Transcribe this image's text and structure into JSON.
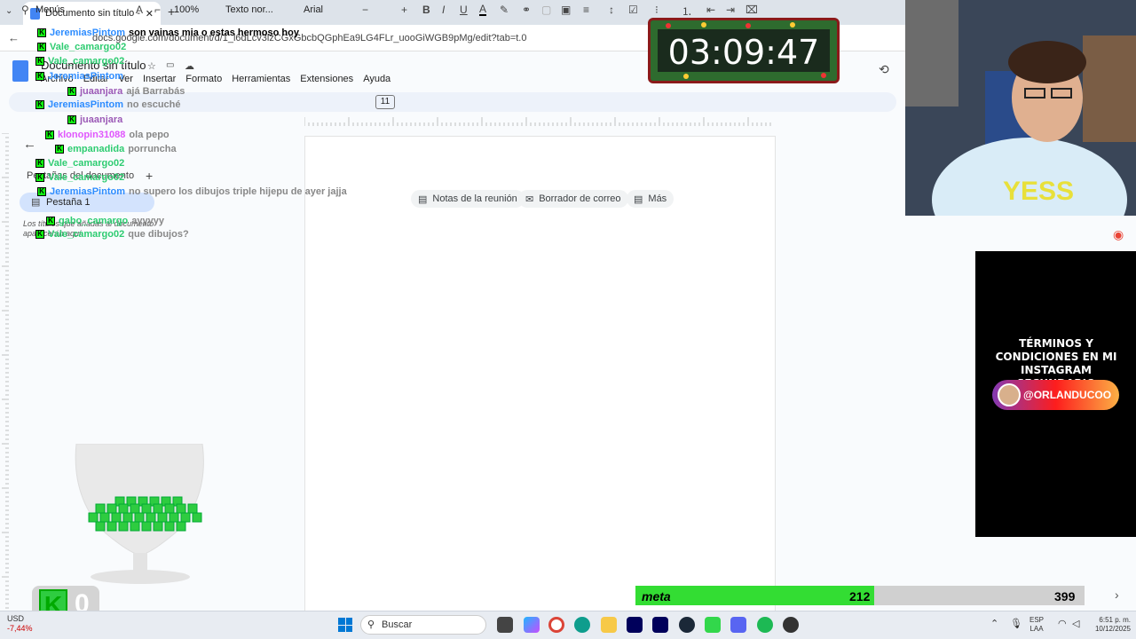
{
  "browser": {
    "tab_title": "Documento sin título - Docume",
    "url": "docs.google.com/document/d/1_l6dLcv3lzCGxGbcbQGphEa9LG4FLr_uooGiWGB9pMg/edit?tab=t.0"
  },
  "docs": {
    "title": "Documento sin título",
    "menu": [
      "Archivo",
      "Editar",
      "Ver",
      "Insertar",
      "Formato",
      "Herramientas",
      "Extensiones",
      "Ayuda"
    ],
    "toolbar": {
      "search": "Menús",
      "zoom": "100%",
      "style": "Texto nor...",
      "font": "Arial",
      "font_size": "11"
    },
    "left_pane": {
      "heading": "Pestañas del documento",
      "tab_label": "Pestaña 1",
      "hint": "Los títulos que añadas al documento aparecerán aquí."
    },
    "chips": [
      {
        "label": "Notas de la reunión",
        "icon": "notes-icon"
      },
      {
        "label": "Borrador de correo",
        "icon": "mail-draft-icon"
      },
      {
        "label": "Más",
        "icon": "more-icon"
      }
    ]
  },
  "chat": [
    {
      "user": "JeremiasPintom",
      "msg": "son vainas mia o estas hermoso hoy",
      "user_color": "#2d8cff",
      "msg_color": "#000000"
    },
    {
      "user": "Vale_camargo02",
      "msg": "",
      "user_color": "#2ecc71",
      "msg_color": "#888888"
    },
    {
      "user": "Vale_camargo02",
      "msg": "",
      "user_color": "#2ecc71",
      "msg_color": "#888888"
    },
    {
      "user": "JeremiasPintom",
      "msg": "",
      "user_color": "#2d8cff",
      "msg_color": "#888888"
    },
    {
      "user": "juaanjara",
      "msg": "ajá Barrabás",
      "user_color": "#9b59b6",
      "msg_color": "#888888"
    },
    {
      "user": "JeremiasPintom",
      "msg": "no escuché",
      "user_color": "#2d8cff",
      "msg_color": "#888888"
    },
    {
      "user": "juaanjara",
      "msg": "",
      "user_color": "#9b59b6",
      "msg_color": "#888888"
    },
    {
      "user": "klonopin31088",
      "msg": "ola pepo",
      "user_color": "#e056fd",
      "msg_color": "#888888"
    },
    {
      "user": "empanadida",
      "msg": "porruncha",
      "user_color": "#2ecc71",
      "msg_color": "#888888"
    },
    {
      "user": "Vale_camargo02",
      "msg": "",
      "user_color": "#2ecc71",
      "msg_color": "#888888"
    },
    {
      "user": "Vale_camargo02",
      "msg": "",
      "user_color": "#2ecc71",
      "msg_color": "#888888"
    },
    {
      "user": "JeremiasPintom",
      "msg": "no supero los dibujos triple hijepu de ayer jajja",
      "user_color": "#2d8cff",
      "msg_color": "#888888"
    },
    {
      "user": "gabo_camargo",
      "msg": "ayyyyy",
      "user_color": "#2ecc71",
      "msg_color": "#888888"
    },
    {
      "user": "Vale_camargo02",
      "msg": "que dibujos?",
      "user_color": "#2ecc71",
      "msg_color": "#888888"
    }
  ],
  "overlay": {
    "timer": "03:09:47",
    "promo_text": "TÉRMINOS Y CONDICIONES EN MI INSTAGRAM SECUNDARIO",
    "instagram_handle": "@ORLANDUCOO",
    "k_count": "0",
    "meta_label": "meta",
    "meta_current": "212",
    "meta_goal": "399",
    "meta_fraction": 0.531
  },
  "taskbar": {
    "stock_name": "USD",
    "stock_change": "-7,44%",
    "search_label": "Buscar",
    "lang": "ESP",
    "lang_sub": "LAA",
    "time": "6:51 p. m.",
    "date": "10/12/2025"
  }
}
